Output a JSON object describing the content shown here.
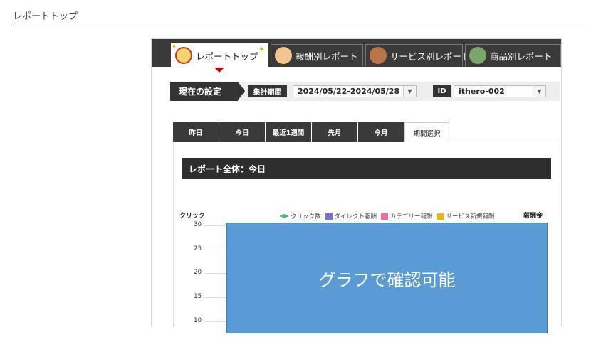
{
  "page": {
    "title": "レポートトップ"
  },
  "nav_tabs": [
    {
      "label": "レポートトップ",
      "icon": "hero-mascot-icon",
      "active": true
    },
    {
      "label": "報酬別レポート",
      "icon": "fox-icon",
      "active": false
    },
    {
      "label": "サービス別レポート",
      "icon": "bear-icon",
      "active": false
    },
    {
      "label": "商品別レポート",
      "icon": "turtle-icon",
      "active": false
    }
  ],
  "settings": {
    "title": "現在の設定",
    "period_label": "集計期間",
    "period_value": "2024/05/22-2024/05/28",
    "id_label": "ID",
    "id_value": "ithero-002"
  },
  "period_tabs": [
    {
      "label": "昨日",
      "active": false
    },
    {
      "label": "今日",
      "active": false
    },
    {
      "label": "最近1週間",
      "active": false
    },
    {
      "label": "先月",
      "active": false
    },
    {
      "label": "今月",
      "active": false
    },
    {
      "label": "期間選択",
      "active": true
    }
  ],
  "report": {
    "header": "レポート全体：今日"
  },
  "chart_data": {
    "type": "bar",
    "ylabel_left": "クリック",
    "ylabel_right": "報酬金",
    "legend": [
      "クリック数",
      "ダイレクト報酬",
      "カテゴリー報酬",
      "サービス新規報酬"
    ],
    "series_colors": [
      "#3cc47b",
      "#7b6fe0",
      "#f06aa7",
      "#f2b705"
    ],
    "y_ticks": [
      "30",
      "25",
      "20",
      "15",
      "10"
    ],
    "ylim": [
      10,
      30
    ]
  },
  "overlay": {
    "text": "グラフで確認可能",
    "color": "#5b9bd5"
  }
}
